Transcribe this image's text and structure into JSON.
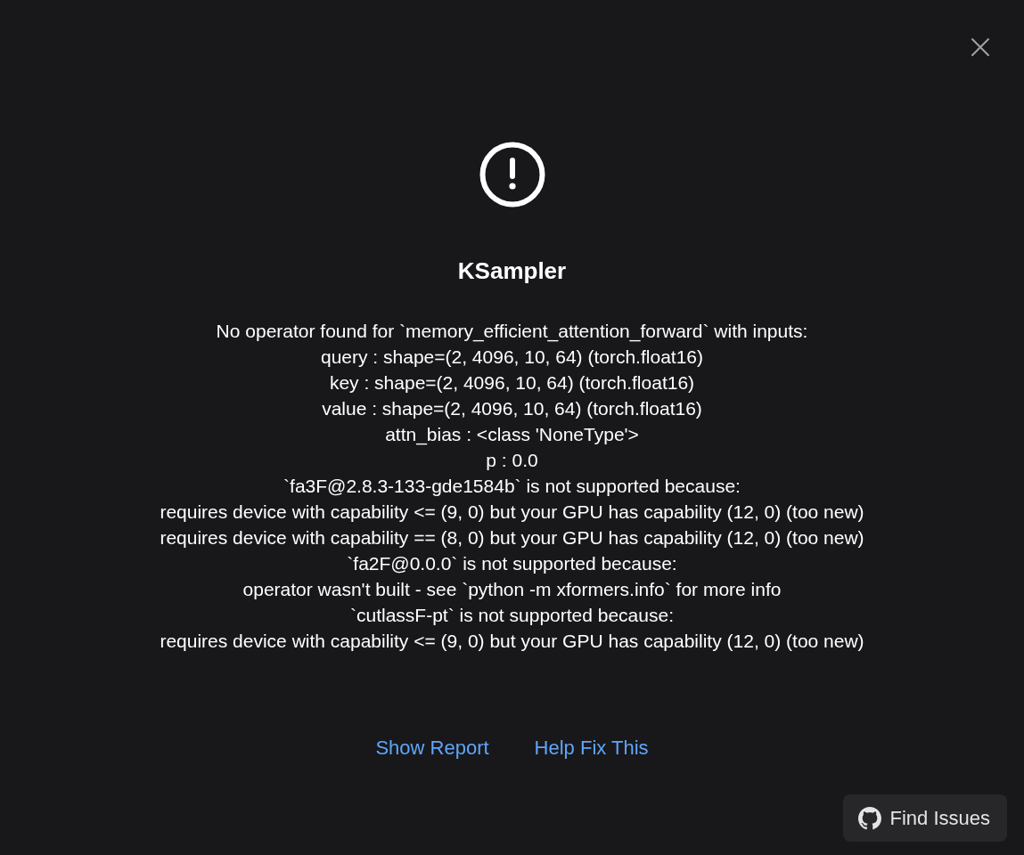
{
  "dialog": {
    "title": "KSampler",
    "message_lines": [
      "No operator found for `memory_efficient_attention_forward` with inputs:",
      "query : shape=(2, 4096, 10, 64) (torch.float16)",
      "key : shape=(2, 4096, 10, 64) (torch.float16)",
      "value : shape=(2, 4096, 10, 64) (torch.float16)",
      "attn_bias : <class 'NoneType'>",
      "p : 0.0",
      "`fa3F@2.8.3-133-gde1584b` is not supported because:",
      "requires device with capability <= (9, 0) but your GPU has capability (12, 0) (too new)",
      "requires device with capability == (8, 0) but your GPU has capability (12, 0) (too new)",
      "`fa2F@0.0.0` is not supported because:",
      "operator wasn't built - see `python -m xformers.info` for more info",
      "`cutlassF-pt` is not supported because:",
      "requires device with capability <= (9, 0) but your GPU has capability (12, 0) (too new)"
    ],
    "links": [
      "Show Report",
      "Help Fix This"
    ],
    "find_issues_button": "Find Issues"
  }
}
